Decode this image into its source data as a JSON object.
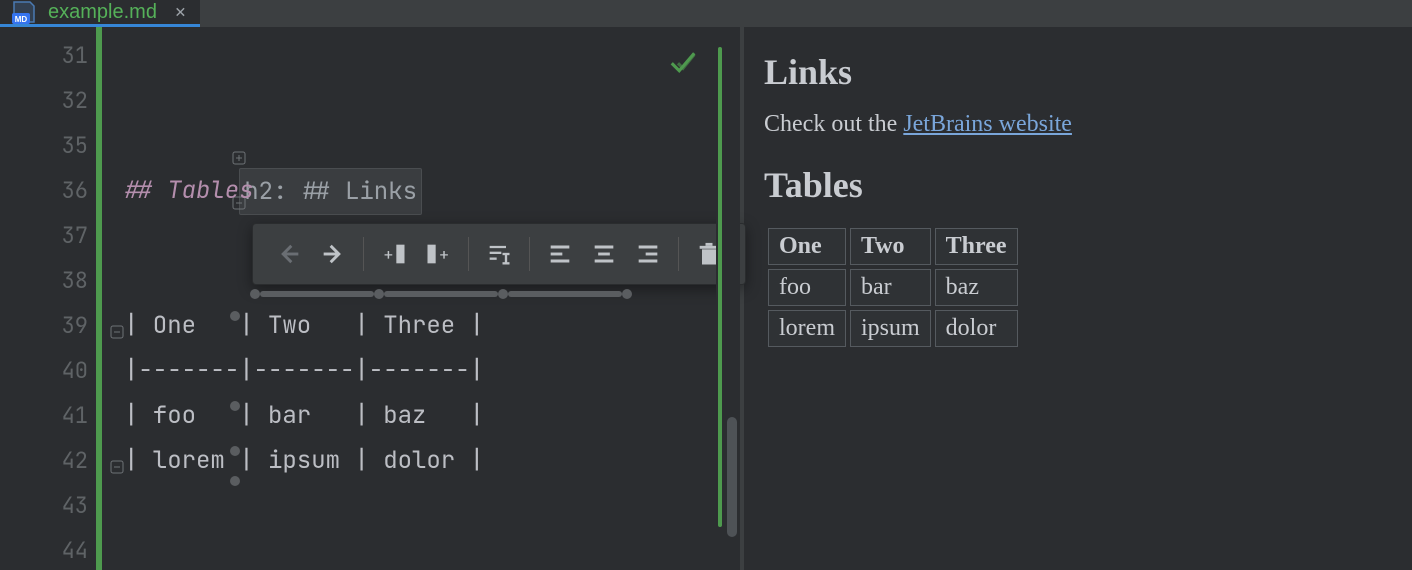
{
  "tab": {
    "filename": "example.md"
  },
  "gutter_lines": [
    "31",
    "32",
    "35",
    "36",
    "37",
    "38",
    "39",
    "40",
    "41",
    "42",
    "43",
    "44"
  ],
  "editor": {
    "folded_region_text": "h2: ## Links",
    "heading_line": "## Tables",
    "table": {
      "row_header": "| One   | Two   | Three |",
      "row_sep": "|-------|-------|-------|",
      "row_1": "| foo   | bar   | baz   |",
      "row_2": "| lorem | ipsum | dolor |"
    }
  },
  "toolbar": {
    "prev": "←",
    "next": "→",
    "insert_col_before": "+▮",
    "insert_col_after": "▮+",
    "rename": "✎",
    "align_left": "≡",
    "align_center": "≡",
    "align_right": "≡",
    "delete": "🗑"
  },
  "preview": {
    "h2_links": "Links",
    "para_prefix": "Check out the ",
    "link_text": "JetBrains website",
    "h2_tables": "Tables",
    "headers": [
      "One",
      "Two",
      "Three"
    ],
    "rows": [
      [
        "foo",
        "bar",
        "baz"
      ],
      [
        "lorem",
        "ipsum",
        "dolor"
      ]
    ]
  }
}
